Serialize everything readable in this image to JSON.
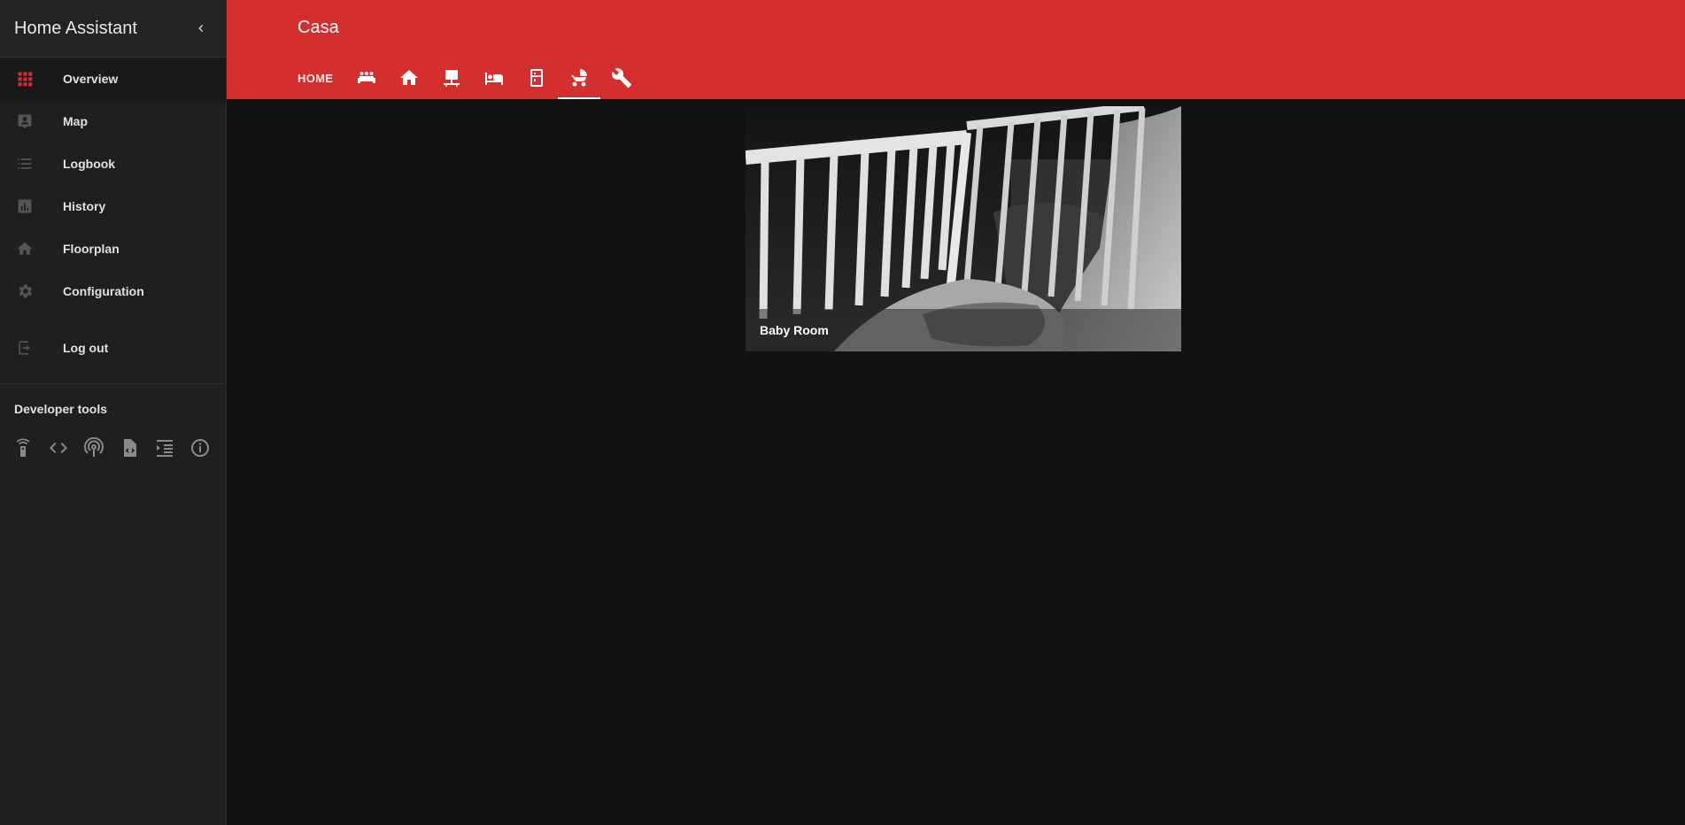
{
  "sidebar": {
    "app_title": "Home Assistant",
    "nav": [
      {
        "label": "Overview",
        "icon": "grid-icon",
        "active": true
      },
      {
        "label": "Map",
        "icon": "map-account-icon"
      },
      {
        "label": "Logbook",
        "icon": "list-icon"
      },
      {
        "label": "History",
        "icon": "chart-icon"
      },
      {
        "label": "Floorplan",
        "icon": "home-icon"
      },
      {
        "label": "Configuration",
        "icon": "gear-icon"
      }
    ],
    "logout_label": "Log out",
    "dev_tools_title": "Developer tools",
    "dev_tools": [
      "remote-icon",
      "code-icon",
      "broadcast-icon",
      "file-code-icon",
      "format-indent-icon",
      "info-icon"
    ]
  },
  "header": {
    "title": "Casa",
    "tabs": [
      {
        "label": "HOME"
      },
      {
        "icon": "sofa-icon"
      },
      {
        "icon": "home-icon"
      },
      {
        "icon": "desk-icon"
      },
      {
        "icon": "bed-icon"
      },
      {
        "icon": "fridge-icon"
      },
      {
        "icon": "baby-carriage-icon",
        "active": true
      },
      {
        "icon": "wrench-icon"
      }
    ]
  },
  "camera": {
    "caption": "Baby Room"
  },
  "colors": {
    "accent": "#d32f2f",
    "sidebar_bg": "#1f1f1f",
    "main_bg": "#121212",
    "active_icon": "#d32f2f"
  }
}
